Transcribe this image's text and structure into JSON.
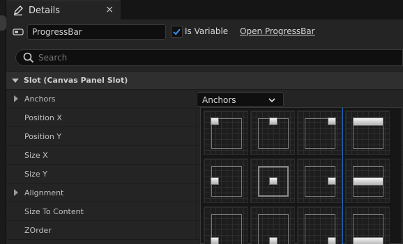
{
  "tab": {
    "title": "Details",
    "close": "×"
  },
  "header": {
    "name_value": "ProgressBar",
    "is_variable_label": "Is Variable",
    "is_variable_checked": true,
    "open_link": "Open ProgressBar"
  },
  "search": {
    "placeholder": "Search"
  },
  "section": {
    "title": "Slot (Canvas Panel Slot)"
  },
  "rows": [
    {
      "label": "Anchors",
      "expandable": true
    },
    {
      "label": "Position X",
      "expandable": false
    },
    {
      "label": "Position Y",
      "expandable": false
    },
    {
      "label": "Size X",
      "expandable": false
    },
    {
      "label": "Size Y",
      "expandable": false
    },
    {
      "label": "Alignment",
      "expandable": true
    },
    {
      "label": "Size To Content",
      "expandable": false
    },
    {
      "label": "ZOrder",
      "expandable": false
    }
  ],
  "anchors_dropdown": {
    "value": "Anchors"
  },
  "anchor_presets": [
    {
      "name": "top-left"
    },
    {
      "name": "top-center"
    },
    {
      "name": "top-right"
    },
    {
      "name": "top-stretch"
    },
    {
      "name": "center-left"
    },
    {
      "name": "center"
    },
    {
      "name": "center-right"
    },
    {
      "name": "center-stretch"
    },
    {
      "name": "bottom-left"
    },
    {
      "name": "bottom-center"
    },
    {
      "name": "bottom-right"
    },
    {
      "name": "bottom-stretch"
    }
  ],
  "colors": {
    "accent": "#1e6fd0",
    "checkbox_check": "#3a8fe8"
  },
  "icons": [
    "pencil-icon",
    "close-icon",
    "widget-icon",
    "check-icon",
    "search-icon",
    "chevron-down-icon",
    "triangle-right-icon",
    "triangle-down-icon"
  ]
}
